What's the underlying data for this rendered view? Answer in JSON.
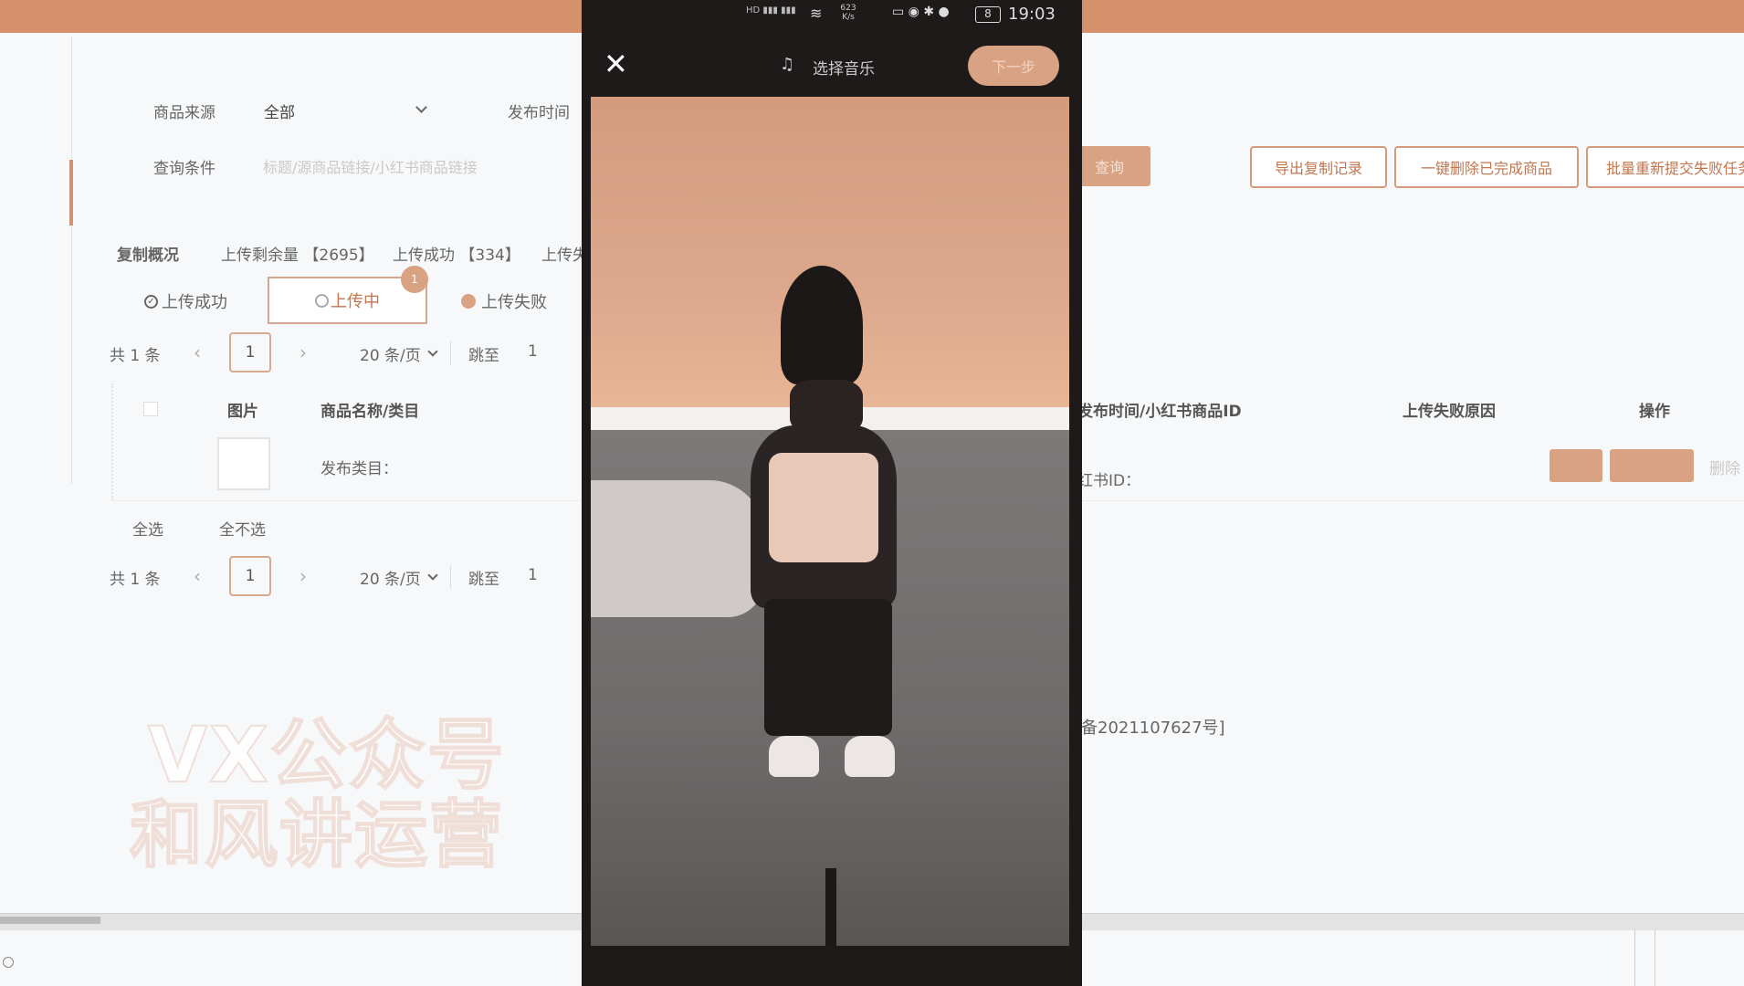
{
  "filters": {
    "source_label": "商品来源",
    "source_value": "全部",
    "publish_time_label": "发布时间",
    "query_label": "查询条件",
    "query_placeholder": "标题/源商品链接/小红书商品链接",
    "search_button": "查询"
  },
  "actions": {
    "export": "导出复制记录",
    "delete_done": "一键删除已完成商品",
    "batch_resubmit": "批量重新提交失败任务"
  },
  "overview": {
    "label": "复制概况",
    "remaining": "上传剩余量 【2695】",
    "success": "上传成功 【334】",
    "failed": "上传失"
  },
  "status_tabs": [
    {
      "label": "上传成功",
      "icon": "check-circle-icon"
    },
    {
      "label": "上传中",
      "icon": "loading-circle-icon",
      "badge": "1",
      "active": true
    },
    {
      "label": "上传失败",
      "icon": "dot-icon"
    }
  ],
  "pager_top": {
    "total": "共 1 条",
    "page": "1",
    "per_page": "20 条/页",
    "jump_label": "跳至",
    "jump_value": "1"
  },
  "table": {
    "headers": [
      "图片",
      "商品名称/类目",
      "发布时间/小红书商品ID",
      "上传失败原因",
      "操作"
    ],
    "row": {
      "category_label": "发布类目：",
      "xhs_id_label": "红书ID：",
      "action_delete": "删除"
    }
  },
  "select_all": "全选",
  "select_none": "全不选",
  "pager_bottom": {
    "total": "共 1 条",
    "page": "1",
    "per_page": "20 条/页",
    "jump_label": "跳至",
    "jump_value": "1"
  },
  "icp": "备2021107627号]",
  "watermark": {
    "line1": "VX公众号",
    "line2": "和风讲运营"
  },
  "phone": {
    "time": "19:03",
    "net_speed": "623 K/s",
    "battery": "8",
    "title": "选择音乐",
    "next": "下一步"
  },
  "colors": {
    "accent": "#d4916c",
    "accent_border": "#d49a7c",
    "phone_bg": "#1e1a19"
  }
}
